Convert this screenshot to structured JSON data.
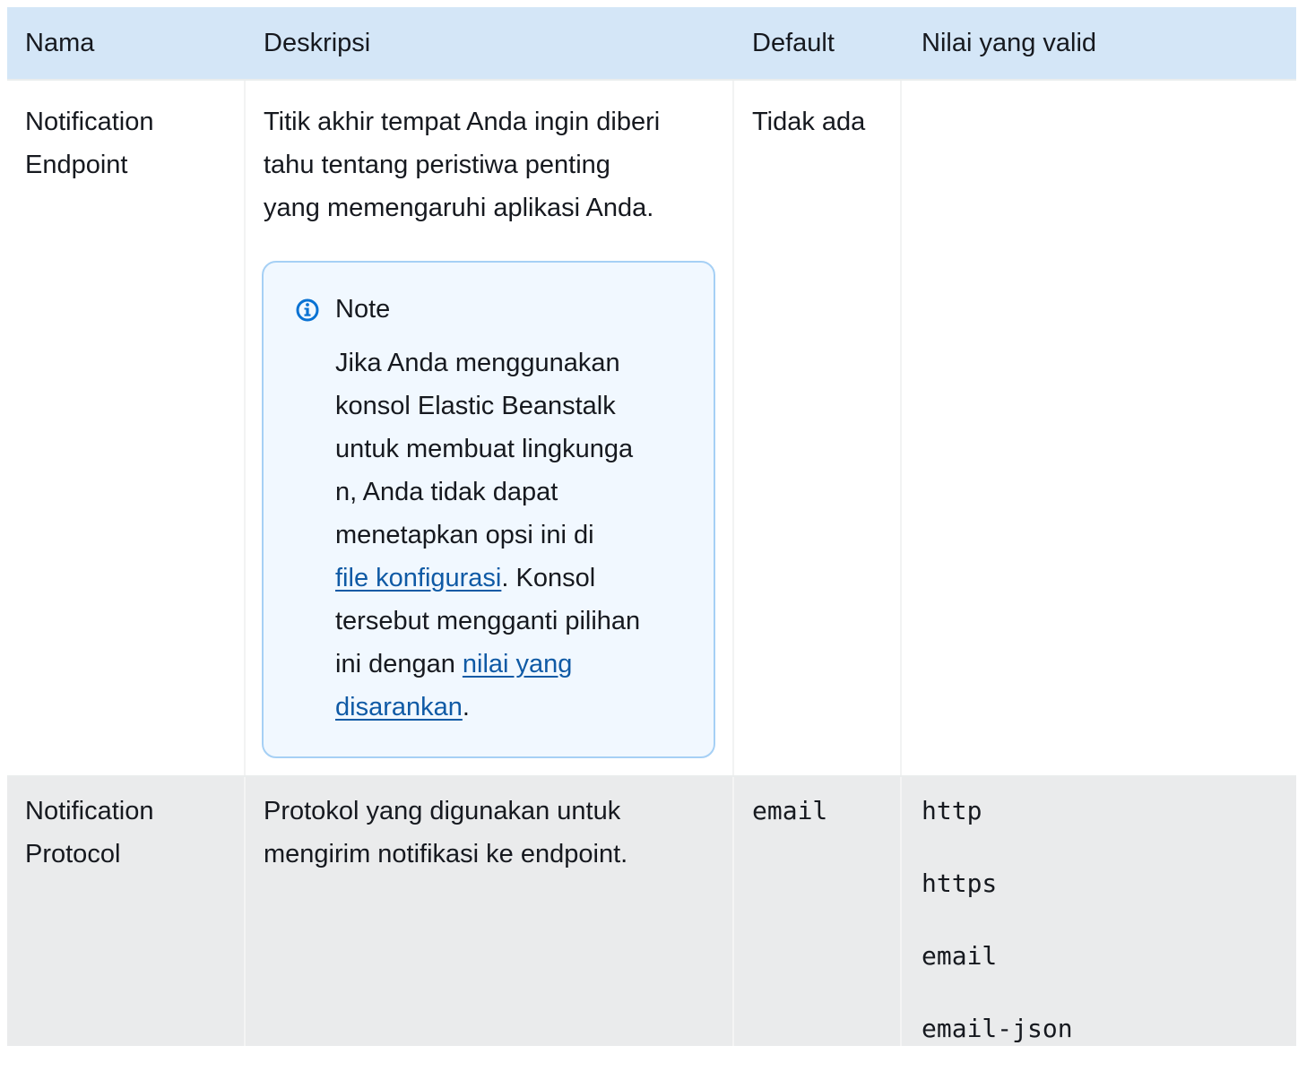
{
  "header": {
    "name": "Nama",
    "description": "Deskripsi",
    "default": "Default",
    "valid_values": "Nilai yang valid"
  },
  "rows": [
    {
      "name_line1": "Notification",
      "name_line2": "Endpoint",
      "desc_line1": "Titik akhir tempat Anda ingin diberi",
      "desc_line2": "tahu tentang peristiwa penting",
      "desc_line3": "yang memengaruhi aplikasi Anda.",
      "default": "Tidak ada",
      "note": {
        "icon": "info-icon",
        "title": "Note",
        "line1": "Jika Anda menggunakan",
        "line2": "konsol Elastic Beanstalk",
        "line3": "untuk membuat lingkunga",
        "line4": "n, Anda tidak dapat",
        "line5": "menetapkan opsi ini di",
        "link1": "file konfigurasi",
        "after_link1": ". Konsol",
        "line7": "tersebut mengganti pilihan",
        "line8_prefix": "ini dengan ",
        "link2_part1": "nilai yang",
        "link2_part2": "disarankan",
        "end": "."
      }
    },
    {
      "name_line1": "Notification",
      "name_line2": "Protocol",
      "desc_line1": "Protokol yang digunakan untuk",
      "desc_line2": "mengirim notifikasi ke endpoint.",
      "default": "email",
      "valid_values": [
        "http",
        "https",
        "email",
        "email-json"
      ]
    }
  ],
  "colors": {
    "header_bg": "#d4e6f7",
    "alt_row_bg": "#eaebec",
    "note_border": "#a6d0f5",
    "note_bg": "#f1f8ff",
    "link": "#0f5aa5",
    "info_icon": "#0972d3"
  }
}
